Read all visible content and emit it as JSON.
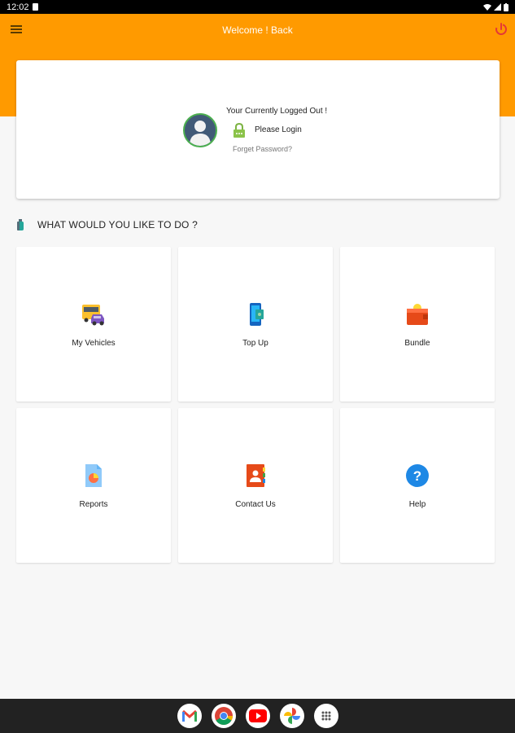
{
  "status_bar": {
    "time": "12:02"
  },
  "app_bar": {
    "title": "Welcome ! Back"
  },
  "login_card": {
    "status_text": "Your Currently Logged Out !",
    "login_label": "Please Login",
    "forgot_label": "Forget Password?"
  },
  "section": {
    "title": "WHAT WOULD YOU LIKE TO DO ?"
  },
  "tiles": [
    {
      "label": "My Vehicles",
      "icon": "vehicles-icon"
    },
    {
      "label": "Top Up",
      "icon": "top-up-icon"
    },
    {
      "label": "Bundle",
      "icon": "bundle-icon"
    },
    {
      "label": "Reports",
      "icon": "reports-icon"
    },
    {
      "label": "Contact Us",
      "icon": "contact-icon"
    },
    {
      "label": "Help",
      "icon": "help-icon"
    }
  ],
  "dock": [
    "gmail-icon",
    "chrome-icon",
    "youtube-icon",
    "photos-icon",
    "app-drawer-icon"
  ],
  "colors": {
    "accent": "#ff9a00",
    "avatar_ring": "#4caf50",
    "power": "#e53935"
  }
}
